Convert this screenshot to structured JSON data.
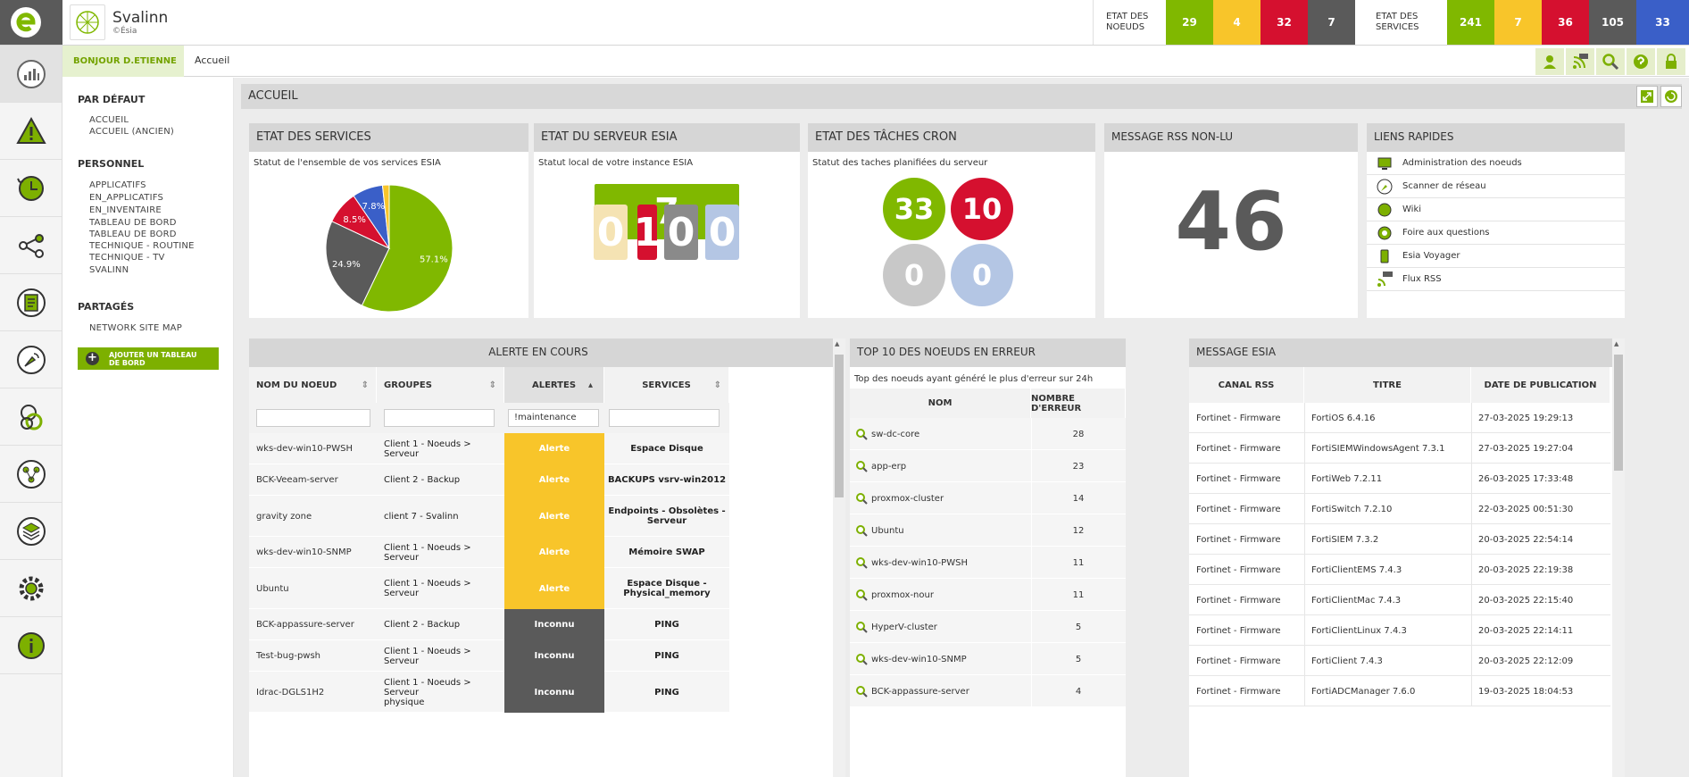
{
  "brand": {
    "name": "Svalinn",
    "sub": "©Ésia"
  },
  "node_stats": {
    "label_line1": "ETAT DES",
    "label_line2": "NOEUDS",
    "values": [
      "29",
      "4",
      "32",
      "7"
    ]
  },
  "service_stats": {
    "label_line1": "ETAT DES",
    "label_line2": "SERVICES",
    "values": [
      "241",
      "7",
      "36",
      "105",
      "33"
    ]
  },
  "colors": {
    "ok": "#80b800",
    "warning": "#f8c52a",
    "critical": "#d5102f",
    "unknown": "#5a5a5a",
    "info": "#3a5fc8"
  },
  "subbar": {
    "greeting": "BONJOUR D.ETIENNE",
    "breadcrumb": "Accueil"
  },
  "toolbar_icons": [
    "user-icon",
    "rss-icon",
    "search-icon",
    "help-icon",
    "lock-icon"
  ],
  "left_nav_icons": [
    "dashboard-icon",
    "alert-icon",
    "history-icon",
    "graph-icon",
    "report-icon",
    "network-scan-icon",
    "link-icon",
    "topology-icon",
    "layers-icon",
    "settings-icon",
    "info-icon"
  ],
  "menu": {
    "default_heading": "PAR DÉFAUT",
    "default_items": [
      "ACCUEIL",
      "ACCUEIL (ANCIEN)"
    ],
    "personal_heading": "PERSONNEL",
    "personal_items": [
      "APPLICATIFS",
      "EN_APPLICATIFS",
      "EN_INVENTAIRE",
      "TABLEAU DE BORD",
      "TABLEAU DE BORD",
      "TECHNIQUE - ROUTINE",
      "TECHNIQUE - TV",
      "SVALINN"
    ],
    "shared_heading": "PARTAGÉS",
    "shared_items": [
      "NETWORK SITE MAP"
    ],
    "add_line1": "AJOUTER UN TABLEAU",
    "add_line2": "DE BORD"
  },
  "page_title": "ACCUEIL",
  "services_panel": {
    "title": "ETAT DES SERVICES",
    "subtitle": "Statut de l'ensemble de vos services ESIA"
  },
  "chart_data": {
    "type": "pie",
    "values": [
      57.1,
      24.9,
      8.5,
      7.8,
      1.7
    ],
    "labels": [
      "57.1%",
      "24.9%",
      "8.5%",
      "7.8%",
      ""
    ],
    "colors": [
      "#80b800",
      "#5a5a5a",
      "#d5102f",
      "#3a5fc8",
      "#f8c52a"
    ]
  },
  "server_panel": {
    "title": "ETAT DU SERVEUR ESIA",
    "subtitle": "Statut local de votre instance ESIA",
    "main_value": "7",
    "small_values": [
      "0",
      "1",
      "0",
      "0"
    ],
    "small_colors": [
      "#f5e3b3",
      "#d5102f",
      "#8a8a8a",
      "#b4c6e4"
    ]
  },
  "cron_panel": {
    "title": "ETAT DES TÂCHES CRON",
    "subtitle": "Statut des taches planifiées du serveur",
    "values": [
      "33",
      "10",
      "0",
      "0"
    ],
    "colors": [
      "#80b800",
      "#d5102f",
      "#c8c8c8",
      "#b4c6e4"
    ]
  },
  "rss_panel": {
    "title": "MESSAGE RSS NON-LU",
    "value": "46"
  },
  "quick_links": {
    "title": "LIENS RAPIDES",
    "items": [
      {
        "label": "Administration des noeuds",
        "icon": "admin-icon"
      },
      {
        "label": "Scanner de réseau",
        "icon": "scanner-icon"
      },
      {
        "label": "Wiki",
        "icon": "wiki-icon"
      },
      {
        "label": "Foire aux questions",
        "icon": "faq-icon"
      },
      {
        "label": "Esia Voyager",
        "icon": "phone-icon"
      },
      {
        "label": "Flux RSS",
        "icon": "rss-icon"
      }
    ]
  },
  "alerts": {
    "title": "ALERTE EN COURS",
    "columns": [
      "NOM DU NOEUD",
      "GROUPES",
      "ALERTES",
      "SERVICES"
    ],
    "filter_value": "!maintenance",
    "rows": [
      {
        "node": "wks-dev-win10-PWSH",
        "group": "Client 1 - Noeuds > Serveur",
        "group2": "",
        "status": "Alerte",
        "service": "Espace Disque",
        "service2": ""
      },
      {
        "node": "BCK-Veeam-server",
        "group": "Client 2 - Backup",
        "group2": "",
        "status": "Alerte",
        "service": "BACKUPS vsrv-win2012",
        "service2": ""
      },
      {
        "node": "gravity zone",
        "group": "client 7 - Svalinn",
        "group2": "",
        "status": "Alerte",
        "service": "Endpoints - Obsolètes -",
        "service2": "Serveur"
      },
      {
        "node": "wks-dev-win10-SNMP",
        "group": "Client 1 - Noeuds > Serveur",
        "group2": "",
        "status": "Alerte",
        "service": "Mémoire SWAP",
        "service2": ""
      },
      {
        "node": "Ubuntu",
        "group": "Client 1 - Noeuds > Serveur",
        "group2": "",
        "status": "Alerte",
        "service": "Espace Disque -",
        "service2": "Physical_memory"
      },
      {
        "node": "BCK-appassure-server",
        "group": "Client 2 - Backup",
        "group2": "",
        "status": "Inconnu",
        "service": "PING",
        "service2": ""
      },
      {
        "node": "Test-bug-pwsh",
        "group": "Client 1 - Noeuds > Serveur",
        "group2": "",
        "status": "Inconnu",
        "service": "PING",
        "service2": ""
      },
      {
        "node": "Idrac-DGLS1H2",
        "group": "Client 1 - Noeuds > Serveur",
        "group2": "physique",
        "status": "Inconnu",
        "service": "PING",
        "service2": ""
      }
    ]
  },
  "top10": {
    "title": "TOP 10 DES NOEUDS EN ERREUR",
    "subtitle": "Top des noeuds ayant généré le plus d'erreur sur 24h",
    "columns": [
      "NOM",
      "NOMBRE D'ERREUR"
    ],
    "rows": [
      {
        "name": "sw-dc-core",
        "count": "28"
      },
      {
        "name": "app-erp",
        "count": "23"
      },
      {
        "name": "proxmox-cluster",
        "count": "14"
      },
      {
        "name": "Ubuntu",
        "count": "12"
      },
      {
        "name": "wks-dev-win10-PWSH",
        "count": "11"
      },
      {
        "name": "proxmox-nour",
        "count": "11"
      },
      {
        "name": "HyperV-cluster",
        "count": "5"
      },
      {
        "name": "wks-dev-win10-SNMP",
        "count": "5"
      },
      {
        "name": "BCK-appassure-server",
        "count": "4"
      }
    ]
  },
  "esia_messages": {
    "title": "MESSAGE ESIA",
    "columns": [
      "CANAL RSS",
      "TITRE",
      "DATE DE PUBLICATION"
    ],
    "rows": [
      {
        "canal": "Fortinet - Firmware",
        "titre": "FortiOS 6.4.16",
        "date": "27-03-2025 19:29:13"
      },
      {
        "canal": "Fortinet - Firmware",
        "titre": "FortiSIEMWindowsAgent 7.3.1",
        "date": "27-03-2025 19:27:04"
      },
      {
        "canal": "Fortinet - Firmware",
        "titre": "FortiWeb 7.2.11",
        "date": "26-03-2025 17:33:48"
      },
      {
        "canal": "Fortinet - Firmware",
        "titre": "FortiSwitch 7.2.10",
        "date": "22-03-2025 00:51:30"
      },
      {
        "canal": "Fortinet - Firmware",
        "titre": "FortiSIEM 7.3.2",
        "date": "20-03-2025 22:54:14"
      },
      {
        "canal": "Fortinet - Firmware",
        "titre": "FortiClientEMS 7.4.3",
        "date": "20-03-2025 22:19:38"
      },
      {
        "canal": "Fortinet - Firmware",
        "titre": "FortiClientMac 7.4.3",
        "date": "20-03-2025 22:15:40"
      },
      {
        "canal": "Fortinet - Firmware",
        "titre": "FortiClientLinux 7.4.3",
        "date": "20-03-2025 22:14:11"
      },
      {
        "canal": "Fortinet - Firmware",
        "titre": "FortiClient 7.4.3",
        "date": "20-03-2025 22:12:09"
      },
      {
        "canal": "Fortinet - Firmware",
        "titre": "FortiADCManager 7.6.0",
        "date": "19-03-2025 18:04:53"
      }
    ]
  }
}
